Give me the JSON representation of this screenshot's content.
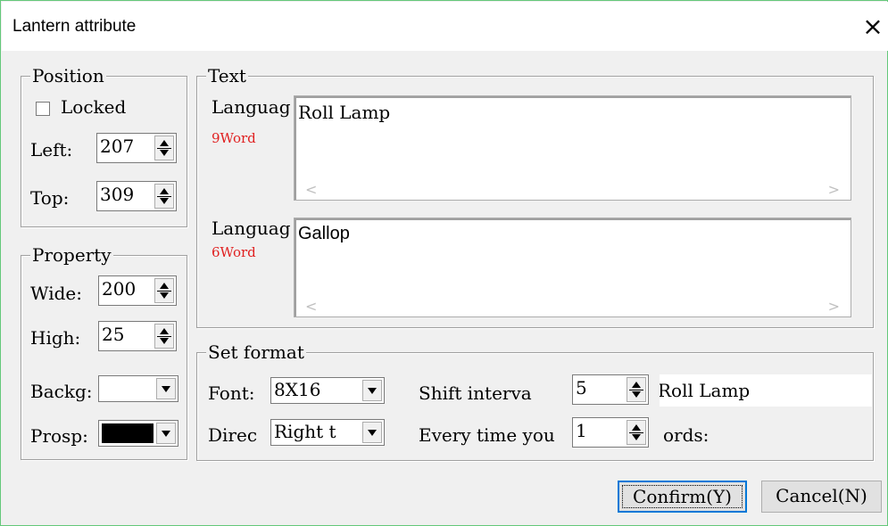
{
  "window": {
    "title": "Lantern attribute",
    "close_glyph": "×"
  },
  "position": {
    "legend": "Position",
    "locked_label": "Locked",
    "locked_checked": false,
    "left_label": "Left:",
    "left_value": "207",
    "top_label": "Top:",
    "top_value": "309"
  },
  "property": {
    "legend": "Property",
    "wide_label": "Wide:",
    "wide_value": "200",
    "high_label": "High:",
    "high_value": "25",
    "backg_label": "Backg:",
    "backg_color": "#ffffff",
    "prosp_label": "Prosp:",
    "prosp_color": "#000000"
  },
  "text": {
    "legend": "Text",
    "lang1_label": "Languag",
    "lang1_count": "9Word",
    "lang1_value": "Roll Lamp",
    "lang2_label": "Languag",
    "lang2_count": "6Word",
    "lang2_value": "Gallop"
  },
  "format": {
    "legend": "Set format",
    "font_label": "Font:",
    "font_value": "8X16",
    "direc_label": "Direc",
    "direc_value": "Right t",
    "shift_label": "Shift interva",
    "shift_value": "5",
    "every_label": "Every time you",
    "every_value": "1",
    "words_label": "ords:",
    "preview_text": "Roll Lamp"
  },
  "buttons": {
    "confirm": "Confirm(Y)",
    "cancel": "Cancel(N)"
  },
  "colors": {
    "accent": "#0078d7",
    "count_red": "#e02020",
    "window_border": "#64c87a"
  }
}
